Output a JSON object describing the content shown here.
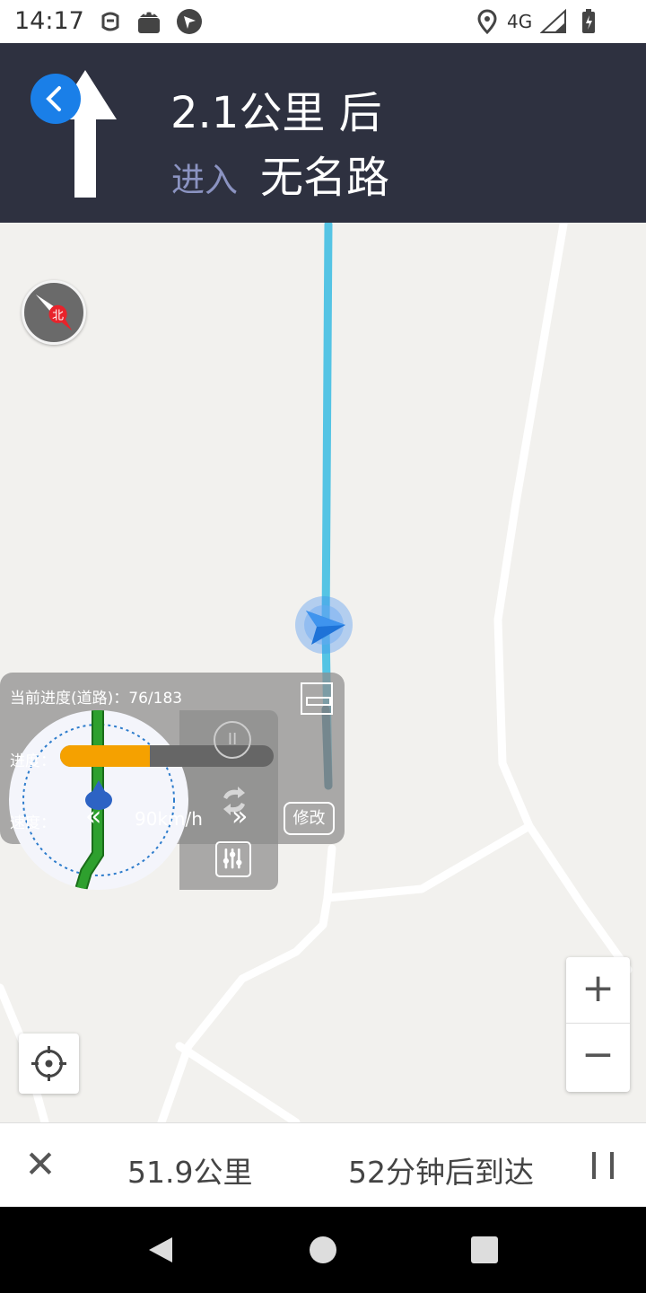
{
  "status_bar": {
    "time": "14:17",
    "network": "4G",
    "icons": [
      "face-icon",
      "android-icon",
      "navigation-icon",
      "location-icon",
      "signal-icon",
      "battery-icon"
    ]
  },
  "nav_header": {
    "distance": "2.1公里 后",
    "enter_label": "进入",
    "road_name": "无名路",
    "turn_icon": "straight-arrow-icon",
    "back_icon": "chevron-left-icon"
  },
  "map": {
    "compass_icon": "compass-north-icon",
    "compass_label": "北",
    "route_color": "#55c4e4",
    "marker_color": "#1e88e5"
  },
  "simulator": {
    "title": "当前进度(道路)：76/183",
    "progress_label": "进度：",
    "progress": 0.42,
    "speed_label": "速度：",
    "speed_value": "90km/h",
    "slower_glyph": "«",
    "faster_glyph": "»",
    "pause_glyph": "II",
    "modify_label": "修改"
  },
  "map_controls": {
    "zoom_in": "+",
    "zoom_out": "−"
  },
  "bottom_bar": {
    "exit_glyph": "✕",
    "remaining_distance": "51.9公里",
    "arrival": "52分钟后到达"
  },
  "colors": {
    "header_bg": "#2e3140",
    "accent_blue": "#1a7fe8",
    "progress_orange": "#f5a100",
    "route_green": "#2ea02e"
  }
}
